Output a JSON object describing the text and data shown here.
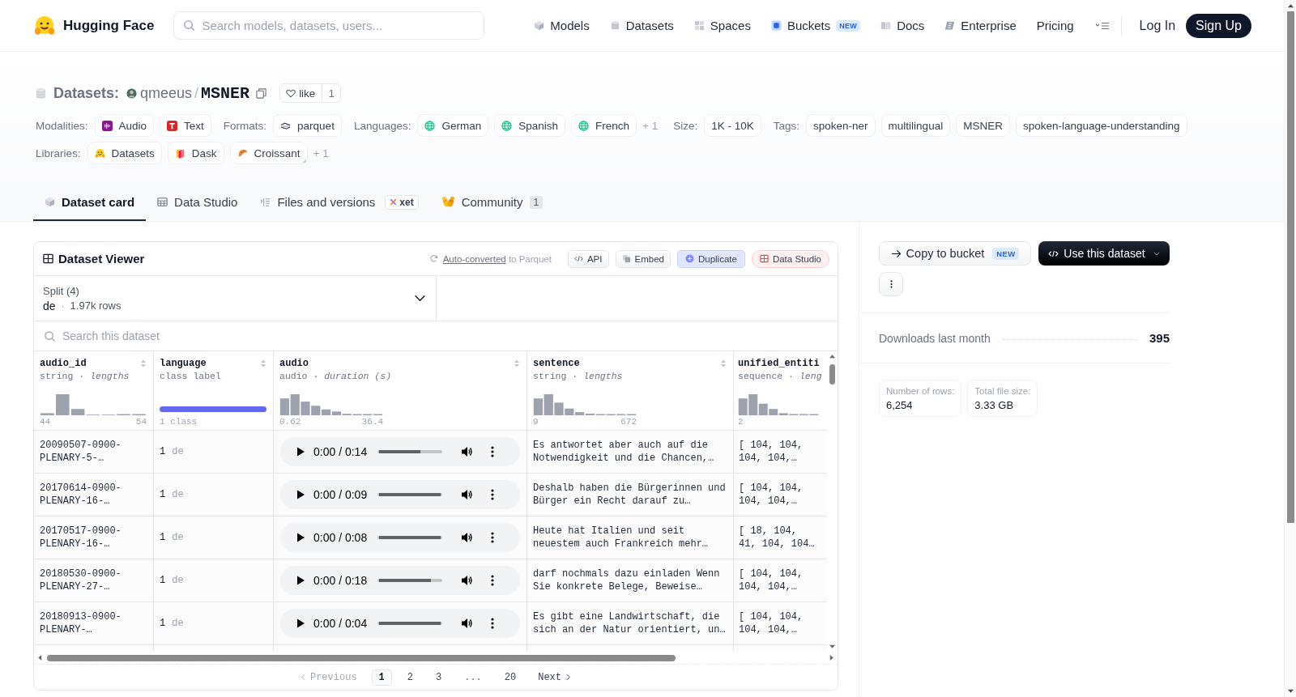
{
  "header": {
    "logo": "Hugging Face",
    "search": {
      "placeholder": "Search models, datasets, users..."
    },
    "nav": [
      {
        "label": "Models"
      },
      {
        "label": "Datasets"
      },
      {
        "label": "Spaces"
      },
      {
        "label": "Buckets",
        "badge": "NEW"
      },
      {
        "label": "Docs"
      },
      {
        "label": "Enterprise"
      },
      {
        "label": "Pricing"
      }
    ],
    "login": "Log In",
    "signup": "Sign Up"
  },
  "repo": {
    "type_label": "Datasets:",
    "owner": "qmeeus",
    "separator": "/",
    "name": "MSNER",
    "like": {
      "label": "like",
      "count": "1"
    }
  },
  "meta_rows": [
    [
      {
        "label": "Modalities:",
        "chips": [
          {
            "label": "Audio",
            "kind": "audio"
          },
          {
            "label": "Text",
            "kind": "text"
          }
        ]
      },
      {
        "label": "Formats:",
        "chips": [
          {
            "label": "parquet",
            "kind": "parquet"
          }
        ]
      },
      {
        "label": "Languages:",
        "chips": [
          {
            "label": "German",
            "kind": "globe"
          },
          {
            "label": "Spanish",
            "kind": "globe"
          },
          {
            "label": "French",
            "kind": "globe"
          }
        ],
        "more": "+ 1"
      },
      {
        "label": "Size:",
        "chips": [
          {
            "label": "1K - 10K"
          }
        ]
      },
      {
        "label": "Tags:",
        "chips": [
          {
            "label": "spoken-ner"
          },
          {
            "label": "multilingual"
          },
          {
            "label": "MSNER"
          },
          {
            "label": "spoken-language-understanding"
          }
        ]
      }
    ],
    [
      {
        "label": "Libraries:",
        "chips": [
          {
            "label": "Datasets",
            "kind": "datasets",
            "dropdown": false
          },
          {
            "label": "Dask",
            "kind": "dask",
            "dropdown": false
          },
          {
            "label": "Croissant",
            "kind": "croissant",
            "dropdown": true
          }
        ],
        "more": "+ 1"
      }
    ]
  ],
  "tabs": [
    {
      "label": "Dataset card",
      "selected": true
    },
    {
      "label": "Data Studio",
      "selected": false
    },
    {
      "label": "Files and versions",
      "badge": "xet",
      "selected": false
    },
    {
      "label": "Community",
      "count": "1",
      "selected": false
    }
  ],
  "viewer": {
    "title": "Dataset Viewer",
    "conversion_note": {
      "link": "Auto-converted",
      "text": "to Parquet"
    },
    "actions": [
      {
        "label": "API",
        "kind": "code"
      },
      {
        "label": "Embed",
        "kind": "embed"
      },
      {
        "label": "Duplicate",
        "kind": "duplicate"
      },
      {
        "label": "Data Studio",
        "kind": "studio"
      }
    ],
    "split": {
      "label": "Split (4)",
      "value": "de",
      "separator": "·",
      "detail": "1.97k rows"
    },
    "search": {
      "placeholder": "Search this dataset"
    },
    "columns": [
      {
        "name": "audio_id",
        "type": "string · *lengths*",
        "kind": "histogram",
        "min": "44",
        "max": "54",
        "sortable": true
      },
      {
        "name": "language",
        "type": "class label",
        "kind": "classes",
        "summary": "1 class",
        "sortable": true
      },
      {
        "name": "audio",
        "type": "audio · *duration (s)*",
        "kind": "histogram",
        "min": "0.62",
        "max": "36.4",
        "sortable": true
      },
      {
        "name": "sentence",
        "type": "string · *lengths*",
        "kind": "histogram",
        "min": "9",
        "max": "672",
        "sortable": true
      },
      {
        "name": "unified_entiti",
        "type": "sequence · *leng*",
        "kind": "histogram",
        "min": "2",
        "sortable": false
      }
    ],
    "rows": [
      {
        "audio_id": "20090507-0900-PLENARY-5-…",
        "class_index": "1",
        "class_label": "de",
        "audio": {
          "time": "0:00 / 0:14",
          "level": 0.67
        },
        "sentence": "Es antwortet aber auch auf die Notwendigkeit und die Chancen,…",
        "entities": "[ 104, 104, 104, 104,…"
      },
      {
        "audio_id": "20170614-0900-PLENARY-16-…",
        "class_index": "1",
        "class_label": "de",
        "audio": {
          "time": "0:00 / 0:09",
          "level": 1
        },
        "sentence": "Deshalb haben die Bürgerinnen und Bürger ein Recht darauf zu…",
        "entities": "[ 104, 104, 104, 104,…"
      },
      {
        "audio_id": "20170517-0900-PLENARY-16-…",
        "class_index": "1",
        "class_label": "de",
        "audio": {
          "time": "0:00 / 0:08",
          "level": 1
        },
        "sentence": "Heute hat Italien und seit neuestem auch Frankreich mehr…",
        "entities": "[ 18, 104, 41, 104, 104…"
      },
      {
        "audio_id": "20180530-0900-PLENARY-27-…",
        "class_index": "1",
        "class_label": "de",
        "audio": {
          "time": "0:00 / 0:18",
          "level": 0.84
        },
        "sentence": "darf nochmals dazu einladen Wenn Sie konkrete Belege, Beweise…",
        "entities": "[ 104, 104, 104, 104,…"
      },
      {
        "audio_id": "20180913-0900-PLENARY-…",
        "class_index": "1",
        "class_label": "de",
        "audio": {
          "time": "0:00 / 0:04",
          "level": 1
        },
        "sentence": "Es gibt eine Landwirtschaft, die sich an der Natur orientiert, un…",
        "entities": "[ 104, 104, 104, 104,…"
      }
    ],
    "pagination": {
      "previous": {
        "label": "Previous",
        "disabled": true
      },
      "pages": [
        {
          "label": "1",
          "kind": "page",
          "selected": true
        },
        {
          "label": "2",
          "kind": "page",
          "selected": false
        },
        {
          "label": "3",
          "kind": "page",
          "selected": false
        },
        {
          "label": "...",
          "kind": "gap",
          "selected": false
        },
        {
          "label": "20",
          "kind": "page",
          "selected": false
        }
      ],
      "next": {
        "label": "Next",
        "disabled": false
      }
    }
  },
  "sidebar": {
    "actions": [
      {
        "label": "Copy to bucket",
        "badge": "NEW",
        "kind": "secondary"
      },
      {
        "label": "Use this dataset",
        "kind": "primary"
      }
    ],
    "downloads": {
      "label": "Downloads last month",
      "value": "395"
    },
    "stats": [
      {
        "label": "Number of rows:",
        "value": "6,254"
      },
      {
        "label": "Total file size:",
        "value": "3.33 GB"
      }
    ]
  }
}
